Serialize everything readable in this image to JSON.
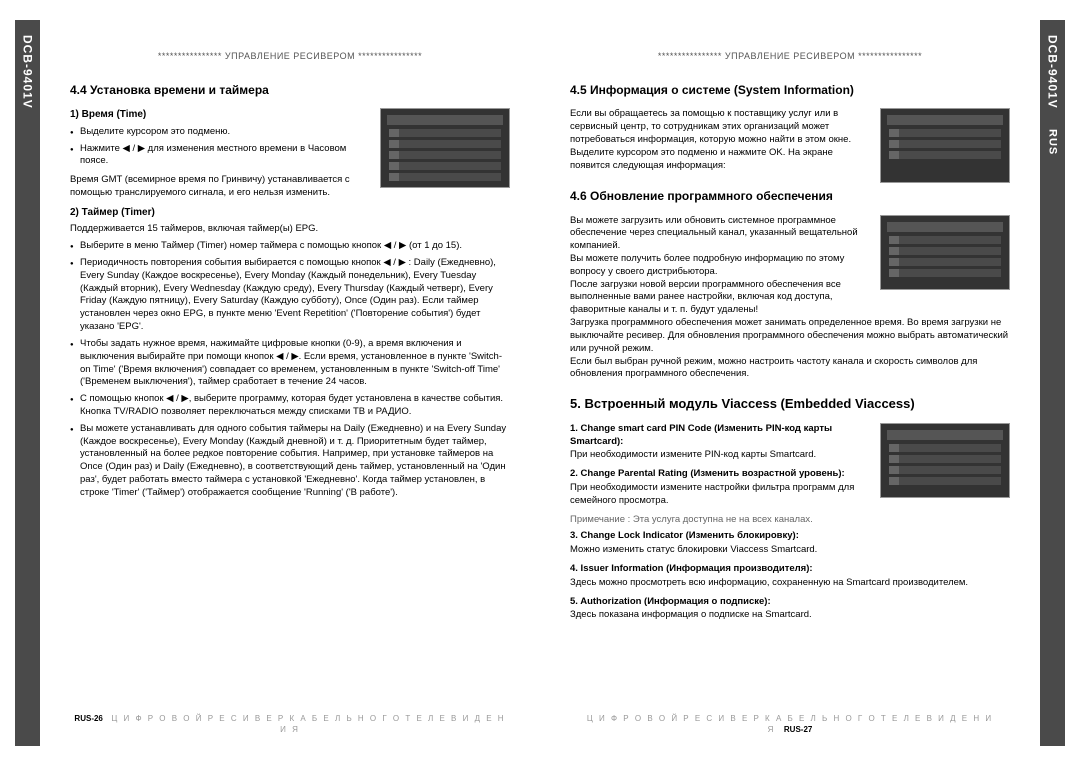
{
  "model": "DCB-9401V",
  "lang": "RUS",
  "header": "****************  УПРАВЛЕНИЕ РЕСИВЕРОМ  ****************",
  "left": {
    "s44_title": "4.4 Установка времени и таймера",
    "p1_title": "1) Время (Time)",
    "p1_b1": "Выделите курсором это подменю.",
    "p1_b2": "Нажмите ◀ / ▶ для изменения местного времени в Часовом поясе.",
    "p1_body": "Время GMT (всемирное время по Гринвичу) устанавливается с помощью транслируемого сигнала, и его нельзя изменить.",
    "p2_title": "2) Таймер (Timer)",
    "p2_body": "Поддерживается 15 таймеров, включая таймер(ы) EPG.",
    "bul_a": "Выберите в меню Таймер (Timer) номер таймера с помощью кнопок ◀ / ▶ (от 1 до 15).",
    "bul_b": "Периодичность повторения события выбирается с помощью кнопок ◀ / ▶ : Daily (Ежедневно), Every Sunday (Каждое воскресенье), Every Monday (Каждый понедельник), Every Tuesday (Каждый вторник), Every Wednesday (Каждую среду), Every Thursday (Каждый четверг), Every Friday (Каждую пятницу), Every Saturday (Каждую субботу), Once (Один раз). Если таймер установлен через окно EPG, в пункте меню 'Event Repetition' ('Повторение события') будет указано 'EPG'.",
    "bul_c": "Чтобы задать нужное время, нажимайте цифровые кнопки (0-9), а время включения и выключения выбирайте при помощи кнопок ◀ / ▶. Если время, установленное в пункте 'Switch-on Time' ('Время включения') совпадает со временем, установленным в пункте 'Switch-off Time' ('Временем выключения'), таймер сработает в течение 24 часов.",
    "bul_d": "С помощью кнопок ◀ / ▶, выберите программу, которая будет установлена в качестве события. Кнопка TV/RADIO позволяет переключаться между списками ТВ и РАДИО.",
    "bul_e": "Вы можете устанавливать для одного события таймеры на Daily (Ежедневно) и на Every Sunday (Каждое воскресенье), Every Monday (Каждый дневной) и т. д. Приоритетным будет таймер, установленный на более редкое повторение события. Например, при установке таймеров на Once (Один раз) и Daily (Ежедневно), в соответствующий день таймер, установленный на 'Один раз', будет работать вместо таймера с установкой 'Ежедневно'. Когда таймер установлен, в строке 'Timer' ('Таймер') отображается сообщение 'Running' ('В работе')."
  },
  "right": {
    "s45_title": "4.5 Информация о системе (System Information)",
    "s45_body1": "Если вы обращаетесь за помощью к поставщику услуг или в сервисный центр, то сотрудникам этих организаций может потребоваться информация, которую можно найти в этом окне. Выделите курсором это подменю и нажмите OK. На экране появится следующая информация:",
    "s46_title": "4.6 Обновление программного обеспечения",
    "s46_p1": "Вы можете загрузить или обновить системное программное обеспечение через специальный канал, указанный вещательной компанией.",
    "s46_p2": "Вы можете получить более подробную информацию по этому вопросу у своего дистрибьютора.",
    "s46_p3": "После загрузки новой версии программного обеспечения все выполненные вами ранее настройки, включая код доступа, фаворитные каналы и т. п. будут удалены!",
    "s46_p4": "Загрузка программного обеспечения может занимать определенное время. Во время загрузки не выключайте ресивер. Для обновления программного обеспечения можно выбрать автоматический или ручной режим.",
    "s46_p5": "Если был выбран ручной режим, можно настроить частоту канала и скорость символов для обновления программного обеспечения.",
    "s5_title": "5. Встроенный модуль Viaccess (Embedded Viaccess)",
    "n1_t": "1. Change smart card PIN Code (Изменить PIN-код карты Smartcard):",
    "n1_b": "При необходимости измените PIN-код карты Smartcard.",
    "n2_t": "2. Change Parental Rating (Изменить возрастной уровень):",
    "n2_b": "При необходимости измените настройки фильтра программ для семейного просмотра.",
    "note": "Примечание : Эта услуга доступна не на всех каналах.",
    "n3_t": "3. Change Lock Indicator (Изменить блокировку):",
    "n3_b": "Можно изменить статус блокировки Viaccess Smartcard.",
    "n4_t": "4. Issuer Information (Информация производителя):",
    "n4_b": "Здесь можно просмотреть всю информацию, сохраненную на Smartcard производителем.",
    "n5_t": "5. Authorization (Информация о подписке):",
    "n5_b": "Здесь показана информация о подписке на Smartcard."
  },
  "footer_left": "RUS-26",
  "footer_right": "RUS-27",
  "footer_text": "Ц И Ф Р О В О Й   Р Е С И В Е Р   К А Б Е Л Ь Н О Г О   Т Е Л Е В И Д Е Н И Я"
}
